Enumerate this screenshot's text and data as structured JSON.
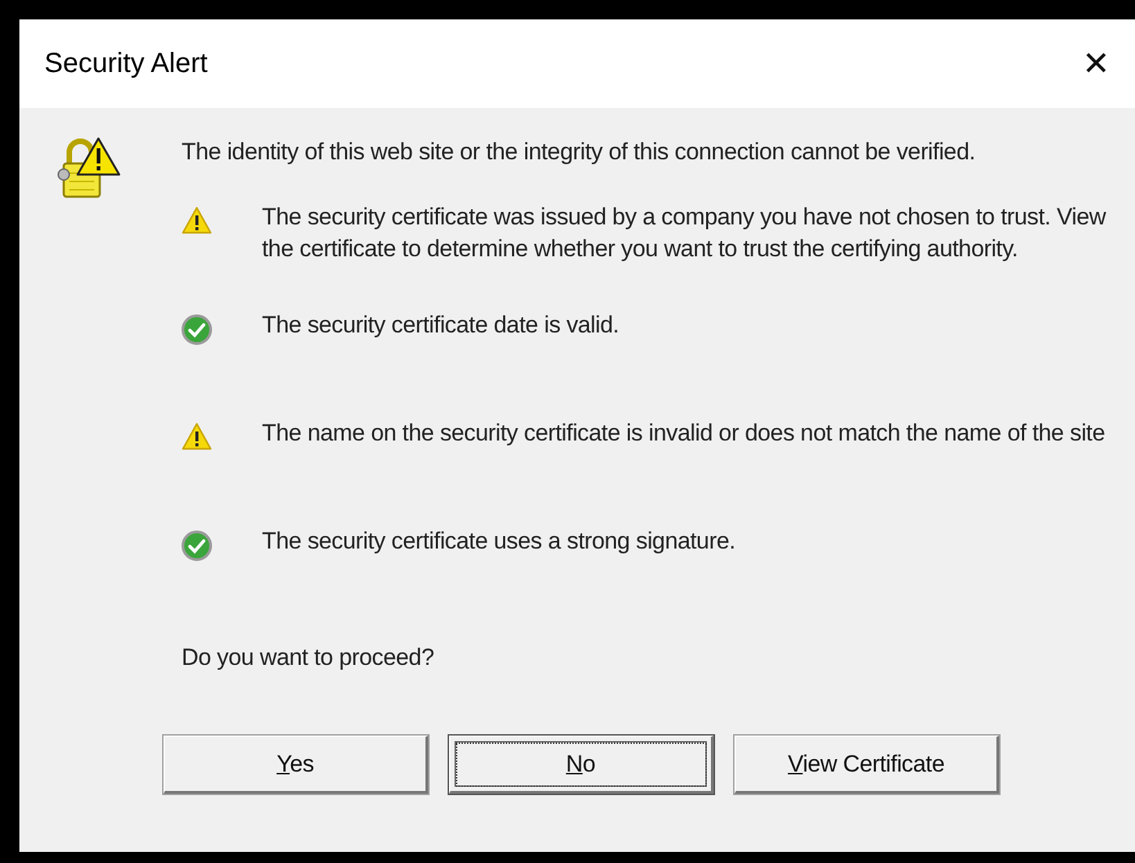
{
  "window": {
    "title": "Security Alert",
    "close": "✕"
  },
  "message": "The identity of this web site or the integrity of this connection cannot be verified.",
  "checks": [
    {
      "kind": "warning",
      "text": "The security certificate was issued by a company you have not chosen to trust. View the certificate to determine whether you want to trust the certifying authority."
    },
    {
      "kind": "ok",
      "text": "The security certificate date is valid."
    },
    {
      "kind": "warning",
      "text": "The name on the security certificate is invalid or does not match the name of the site"
    },
    {
      "kind": "ok",
      "text": "The security certificate uses a strong signature."
    }
  ],
  "question": "Do you want to proceed?",
  "buttons": [
    {
      "label": "Yes",
      "mnemonic": true,
      "focused": false
    },
    {
      "label": "No",
      "mnemonic": true,
      "focused": true
    },
    {
      "label": "View Certificate",
      "mnemonic": true,
      "focused": false
    }
  ]
}
